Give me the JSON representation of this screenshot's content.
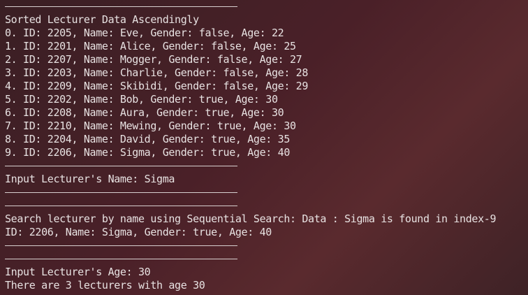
{
  "terminal": {
    "lines": [
      {
        "kind": "sep",
        "text": ""
      },
      {
        "kind": "text",
        "text": "Sorted Lecturer Data Ascendingly"
      },
      {
        "kind": "text",
        "text": "0. ID: 2205, Name: Eve, Gender: false, Age: 22"
      },
      {
        "kind": "text",
        "text": "1. ID: 2201, Name: Alice, Gender: false, Age: 25"
      },
      {
        "kind": "text",
        "text": "2. ID: 2207, Name: Mogger, Gender: false, Age: 27"
      },
      {
        "kind": "text",
        "text": "3. ID: 2203, Name: Charlie, Gender: false, Age: 28"
      },
      {
        "kind": "text",
        "text": "4. ID: 2209, Name: Skibidi, Gender: false, Age: 29"
      },
      {
        "kind": "text",
        "text": "5. ID: 2202, Name: Bob, Gender: true, Age: 30"
      },
      {
        "kind": "text",
        "text": "6. ID: 2208, Name: Aura, Gender: true, Age: 30"
      },
      {
        "kind": "text",
        "text": "7. ID: 2210, Name: Mewing, Gender: true, Age: 30"
      },
      {
        "kind": "text",
        "text": "8. ID: 2204, Name: David, Gender: true, Age: 35"
      },
      {
        "kind": "text",
        "text": "9. ID: 2206, Name: Sigma, Gender: true, Age: 40"
      },
      {
        "kind": "sep",
        "text": ""
      },
      {
        "kind": "text",
        "text": "Input Lecturer's Name: Sigma"
      },
      {
        "kind": "sep",
        "text": ""
      },
      {
        "kind": "sep",
        "text": ""
      },
      {
        "kind": "text",
        "text": "Search lecturer by name using Sequential Search: Data : Sigma is found in index-9"
      },
      {
        "kind": "text",
        "text": "ID: 2206, Name: Sigma, Gender: true, Age: 40"
      },
      {
        "kind": "sep",
        "text": ""
      },
      {
        "kind": "sep",
        "text": ""
      },
      {
        "kind": "text",
        "text": "Input Lecturer's Age: 30"
      },
      {
        "kind": "text",
        "text": "There are 3 lecturers with age 30"
      }
    ]
  },
  "colors": {
    "text": "#e8e2e2",
    "background_start": "#3a1f24",
    "background_end": "#5a2a2e"
  }
}
